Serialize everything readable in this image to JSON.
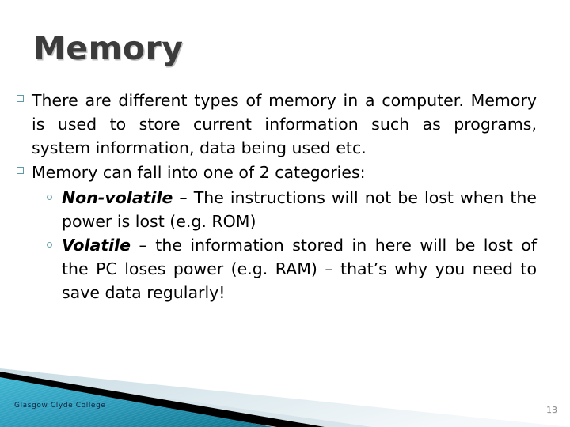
{
  "slide": {
    "title": "Memory",
    "page_number": "13",
    "logo_text": "Glasgow Clyde College",
    "colors": {
      "title": "#3C3C3C",
      "bullet_square": "#5D9AA8",
      "bullet_circle": "#6BA3B0",
      "banner_teal_light": "#4FBDD6",
      "banner_teal_dark": "#1E7E96",
      "banner_black": "#000000",
      "banner_pale": "#DCE7EC",
      "logo_text": "#10223C",
      "page_number": "#8F8F8F"
    },
    "bullets": [
      {
        "level": 1,
        "marker": "hollow-square",
        "text": "There are different types of memory in a computer.  Memory is used to store current information such as programs, system information, data being used etc."
      },
      {
        "level": 1,
        "marker": "hollow-square",
        "text": "Memory can fall into one of 2 categories:"
      },
      {
        "level": 2,
        "marker": "hollow-circle",
        "term": "Non-volatile",
        "text": " – The instructions will not be lost when the power is lost (e.g. ROM)"
      },
      {
        "level": 2,
        "marker": "hollow-circle",
        "term": "Volatile",
        "text": " – the information stored in here will be lost of the PC loses power (e.g. RAM) – that’s why you need to save data regularly!"
      }
    ]
  }
}
